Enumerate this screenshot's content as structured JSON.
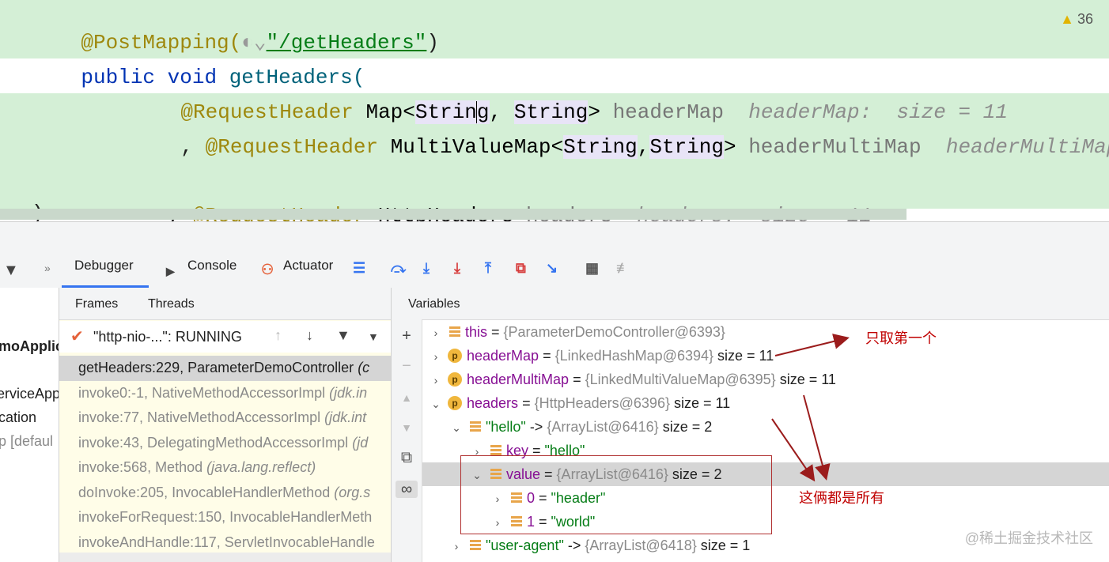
{
  "editor": {
    "warning_count": "36",
    "line_mapping": "@PostMapping(",
    "line_mapping_path": "\"/getHeaders\"",
    "line_mapping_close": ")",
    "line_sig_kw1": "public",
    "line_sig_kw2": "void",
    "line_sig_fn": "getHeaders(",
    "p1_ann": "@RequestHeader",
    "p1_type_a": "Map<",
    "p1_type_b": "Strin",
    "p1_type_c": "g",
    "p1_type_d": ", ",
    "p1_type_e": "String",
    "p1_type_f": ">",
    "p1_name": "headerMap",
    "p1_hint": "headerMap:  size = 11",
    "p2_lead": ", ",
    "p2_ann": "@RequestHeader",
    "p2_type_a": "MultiValueMap<",
    "p2_type_b": "String",
    "p2_type_c": ",",
    "p2_type_d": "String",
    "p2_type_e": ">",
    "p2_name": "headerMultiMap",
    "p2_hint": "headerMultiMap:",
    "p3_lead": ", ",
    "p3_ann": "@RequestHeader",
    "p3_type": "HttpHeaders",
    "p3_name": "headers",
    "p3_hint": "headers:  size = 11",
    "close": ")"
  },
  "toolbar": {
    "tabs": [
      {
        "label": "Debugger"
      },
      {
        "label": "Console"
      },
      {
        "label": "Actuator"
      }
    ]
  },
  "leftpane": {
    "items": [
      "moApplic",
      "erviceApp",
      "cation",
      "p [defaul"
    ]
  },
  "frames": {
    "subtabs": [
      "Frames",
      "Threads"
    ],
    "thread_label": "\"http-nio-...\": RUNNING",
    "items": [
      {
        "text": "getHeaders:229, ParameterDemoController",
        "pkg": "(c"
      },
      {
        "text": "invoke0:-1, NativeMethodAccessorImpl",
        "pkg": "(jdk.in"
      },
      {
        "text": "invoke:77, NativeMethodAccessorImpl",
        "pkg": "(jdk.int"
      },
      {
        "text": "invoke:43, DelegatingMethodAccessorImpl",
        "pkg": "(jd"
      },
      {
        "text": "invoke:568, Method",
        "pkg": "(java.lang.reflect)"
      },
      {
        "text": "doInvoke:205, InvocableHandlerMethod",
        "pkg": "(org.s"
      },
      {
        "text": "invokeForRequest:150, InvocableHandlerMeth",
        "pkg": ""
      },
      {
        "text": "invokeAndHandle:117, ServletInvocableHandle",
        "pkg": ""
      }
    ]
  },
  "variables": {
    "header": "Variables",
    "rows": [
      {
        "name": "this",
        "eq": " = ",
        "obj": "{ParameterDemoController@6393}",
        "size": ""
      },
      {
        "name": "headerMap",
        "eq": " = ",
        "obj": "{LinkedHashMap@6394}",
        "size": "size = 11"
      },
      {
        "name": "headerMultiMap",
        "eq": " = ",
        "obj": "{LinkedMultiValueMap@6395}",
        "size": "size = 11"
      },
      {
        "name": "headers",
        "eq": " = ",
        "obj": "{HttpHeaders@6396}",
        "size": "size = 11"
      },
      {
        "name": "\"hello\"",
        "eq": " -> ",
        "obj": "{ArrayList@6416}",
        "size": "size = 2"
      },
      {
        "name": "key",
        "eq": " = ",
        "obj": "\"hello\"",
        "size": ""
      },
      {
        "name": "value",
        "eq": " = ",
        "obj": "{ArrayList@6416}",
        "size": "size = 2"
      },
      {
        "name": "0",
        "eq": " = ",
        "obj": "\"header\"",
        "size": ""
      },
      {
        "name": "1",
        "eq": " = ",
        "obj": "\"world\"",
        "size": ""
      },
      {
        "name": "\"user-agent\"",
        "eq": " -> ",
        "obj": "{ArrayList@6418}",
        "size": "size = 1"
      }
    ]
  },
  "annotations": {
    "first_only": "只取第一个",
    "both_all": "这俩都是所有"
  },
  "watermark": "@稀土掘金技术社区"
}
